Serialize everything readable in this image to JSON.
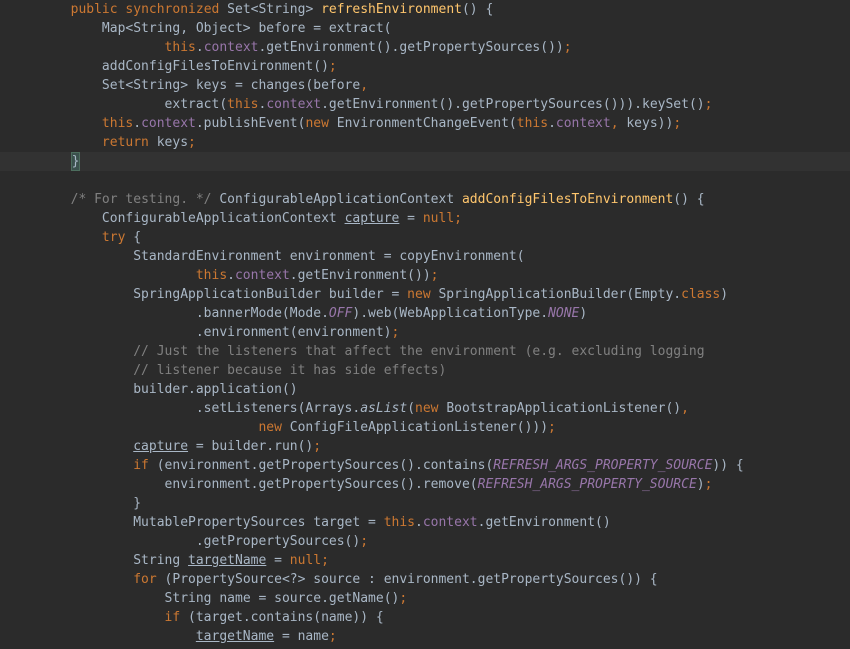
{
  "lines": [
    {
      "indent": 4,
      "tokens": [
        {
          "t": "public ",
          "c": "kw"
        },
        {
          "t": "synchronized ",
          "c": "kw"
        },
        {
          "t": "Set<String> ",
          "c": "type"
        },
        {
          "t": "refreshEnvironment",
          "c": "method-decl"
        },
        {
          "t": "() {",
          "c": "paren"
        }
      ]
    },
    {
      "indent": 8,
      "tokens": [
        {
          "t": "Map<String, Object> before = extract(",
          "c": "type"
        }
      ]
    },
    {
      "indent": 16,
      "tokens": [
        {
          "t": "this",
          "c": "kw"
        },
        {
          "t": ".",
          "c": ""
        },
        {
          "t": "context",
          "c": "field"
        },
        {
          "t": ".getEnvironment().getPropertySources())",
          "c": ""
        },
        {
          "t": ";",
          "c": "kw"
        }
      ]
    },
    {
      "indent": 8,
      "tokens": [
        {
          "t": "addConfigFilesToEnvironment()",
          "c": ""
        },
        {
          "t": ";",
          "c": "kw"
        }
      ]
    },
    {
      "indent": 8,
      "tokens": [
        {
          "t": "Set<String> keys = changes(before",
          "c": "type"
        },
        {
          "t": ",",
          "c": "kw"
        }
      ]
    },
    {
      "indent": 16,
      "tokens": [
        {
          "t": "extract(",
          "c": ""
        },
        {
          "t": "this",
          "c": "kw"
        },
        {
          "t": ".",
          "c": ""
        },
        {
          "t": "context",
          "c": "field"
        },
        {
          "t": ".getEnvironment().getPropertySources())).keySet()",
          "c": ""
        },
        {
          "t": ";",
          "c": "kw"
        }
      ]
    },
    {
      "indent": 8,
      "tokens": [
        {
          "t": "this",
          "c": "kw"
        },
        {
          "t": ".",
          "c": ""
        },
        {
          "t": "context",
          "c": "field"
        },
        {
          "t": ".publishEvent(",
          "c": ""
        },
        {
          "t": "new ",
          "c": "kw"
        },
        {
          "t": "EnvironmentChangeEvent(",
          "c": ""
        },
        {
          "t": "this",
          "c": "kw"
        },
        {
          "t": ".",
          "c": ""
        },
        {
          "t": "context",
          "c": "field"
        },
        {
          "t": ", ",
          "c": "kw"
        },
        {
          "t": "keys))",
          "c": ""
        },
        {
          "t": ";",
          "c": "kw"
        }
      ]
    },
    {
      "indent": 8,
      "tokens": [
        {
          "t": "return ",
          "c": "kw"
        },
        {
          "t": "keys",
          "c": ""
        },
        {
          "t": ";",
          "c": "kw"
        }
      ]
    },
    {
      "indent": 4,
      "highlight": true,
      "tokens": [
        {
          "t": "}",
          "c": "brace-match"
        }
      ]
    },
    {
      "indent": 0,
      "tokens": []
    },
    {
      "indent": 4,
      "tokens": [
        {
          "t": "/* For testing. */",
          "c": "comment"
        },
        {
          "t": " ConfigurableApplicationContext ",
          "c": "type"
        },
        {
          "t": "addConfigFilesToEnvironment",
          "c": "method-decl"
        },
        {
          "t": "() {",
          "c": ""
        }
      ]
    },
    {
      "indent": 8,
      "tokens": [
        {
          "t": "ConfigurableApplicationContext ",
          "c": "type"
        },
        {
          "t": "capture",
          "c": "underline"
        },
        {
          "t": " = ",
          "c": ""
        },
        {
          "t": "null;",
          "c": "kw"
        }
      ]
    },
    {
      "indent": 8,
      "tokens": [
        {
          "t": "try ",
          "c": "kw"
        },
        {
          "t": "{",
          "c": ""
        }
      ]
    },
    {
      "indent": 12,
      "tokens": [
        {
          "t": "StandardEnvironment environment = copyEnvironment(",
          "c": "type"
        }
      ]
    },
    {
      "indent": 20,
      "tokens": [
        {
          "t": "this",
          "c": "kw"
        },
        {
          "t": ".",
          "c": ""
        },
        {
          "t": "context",
          "c": "field"
        },
        {
          "t": ".getEnvironment())",
          "c": ""
        },
        {
          "t": ";",
          "c": "kw"
        }
      ]
    },
    {
      "indent": 12,
      "tokens": [
        {
          "t": "SpringApplicationBuilder builder = ",
          "c": "type"
        },
        {
          "t": "new ",
          "c": "kw"
        },
        {
          "t": "SpringApplicationBuilder(Empty.",
          "c": ""
        },
        {
          "t": "class",
          "c": "kw"
        },
        {
          "t": ")",
          "c": ""
        }
      ]
    },
    {
      "indent": 20,
      "tokens": [
        {
          "t": ".bannerMode(Mode.",
          "c": ""
        },
        {
          "t": "OFF",
          "c": "const"
        },
        {
          "t": ").web(WebApplicationType.",
          "c": ""
        },
        {
          "t": "NONE",
          "c": "const"
        },
        {
          "t": ")",
          "c": ""
        }
      ]
    },
    {
      "indent": 20,
      "tokens": [
        {
          "t": ".environment(environment)",
          "c": ""
        },
        {
          "t": ";",
          "c": "kw"
        }
      ]
    },
    {
      "indent": 12,
      "tokens": [
        {
          "t": "// Just the listeners that affect the environment (e.g. excluding logging",
          "c": "comment"
        }
      ]
    },
    {
      "indent": 12,
      "tokens": [
        {
          "t": "// listener because it has side effects)",
          "c": "comment"
        }
      ]
    },
    {
      "indent": 12,
      "tokens": [
        {
          "t": "builder.application()",
          "c": ""
        }
      ]
    },
    {
      "indent": 20,
      "tokens": [
        {
          "t": ".setListeners(Arrays.",
          "c": ""
        },
        {
          "t": "asList",
          "c": "static-m"
        },
        {
          "t": "(",
          "c": ""
        },
        {
          "t": "new ",
          "c": "kw"
        },
        {
          "t": "BootstrapApplicationListener()",
          "c": ""
        },
        {
          "t": ",",
          "c": "kw"
        }
      ]
    },
    {
      "indent": 28,
      "tokens": [
        {
          "t": "new ",
          "c": "kw"
        },
        {
          "t": "ConfigFileApplicationListener()))",
          "c": ""
        },
        {
          "t": ";",
          "c": "kw"
        }
      ]
    },
    {
      "indent": 12,
      "tokens": [
        {
          "t": "capture",
          "c": "underline"
        },
        {
          "t": " = builder.run()",
          "c": ""
        },
        {
          "t": ";",
          "c": "kw"
        }
      ]
    },
    {
      "indent": 12,
      "tokens": [
        {
          "t": "if ",
          "c": "kw"
        },
        {
          "t": "(environment.getPropertySources().contains(",
          "c": ""
        },
        {
          "t": "REFRESH_ARGS_PROPERTY_SOURCE",
          "c": "const"
        },
        {
          "t": ")) {",
          "c": ""
        }
      ]
    },
    {
      "indent": 16,
      "tokens": [
        {
          "t": "environment.getPropertySources().remove(",
          "c": ""
        },
        {
          "t": "REFRESH_ARGS_PROPERTY_SOURCE",
          "c": "const"
        },
        {
          "t": ")",
          "c": ""
        },
        {
          "t": ";",
          "c": "kw"
        }
      ]
    },
    {
      "indent": 12,
      "tokens": [
        {
          "t": "}",
          "c": ""
        }
      ]
    },
    {
      "indent": 12,
      "tokens": [
        {
          "t": "MutablePropertySources target = ",
          "c": "type"
        },
        {
          "t": "this",
          "c": "kw"
        },
        {
          "t": ".",
          "c": ""
        },
        {
          "t": "context",
          "c": "field"
        },
        {
          "t": ".getEnvironment()",
          "c": ""
        }
      ]
    },
    {
      "indent": 20,
      "tokens": [
        {
          "t": ".getPropertySources()",
          "c": ""
        },
        {
          "t": ";",
          "c": "kw"
        }
      ]
    },
    {
      "indent": 12,
      "tokens": [
        {
          "t": "String ",
          "c": "type"
        },
        {
          "t": "targetName",
          "c": "underline"
        },
        {
          "t": " = ",
          "c": ""
        },
        {
          "t": "null;",
          "c": "kw"
        }
      ]
    },
    {
      "indent": 12,
      "tokens": [
        {
          "t": "for ",
          "c": "kw"
        },
        {
          "t": "(PropertySource<?> source : environment.getPropertySources()) {",
          "c": "type"
        }
      ]
    },
    {
      "indent": 16,
      "tokens": [
        {
          "t": "String name = source.getName()",
          "c": "type"
        },
        {
          "t": ";",
          "c": "kw"
        }
      ]
    },
    {
      "indent": 16,
      "tokens": [
        {
          "t": "if ",
          "c": "kw"
        },
        {
          "t": "(target.contains(name)) {",
          "c": ""
        }
      ]
    },
    {
      "indent": 20,
      "tokens": [
        {
          "t": "targetName",
          "c": "underline"
        },
        {
          "t": " = name",
          "c": ""
        },
        {
          "t": ";",
          "c": "kw"
        }
      ]
    }
  ]
}
